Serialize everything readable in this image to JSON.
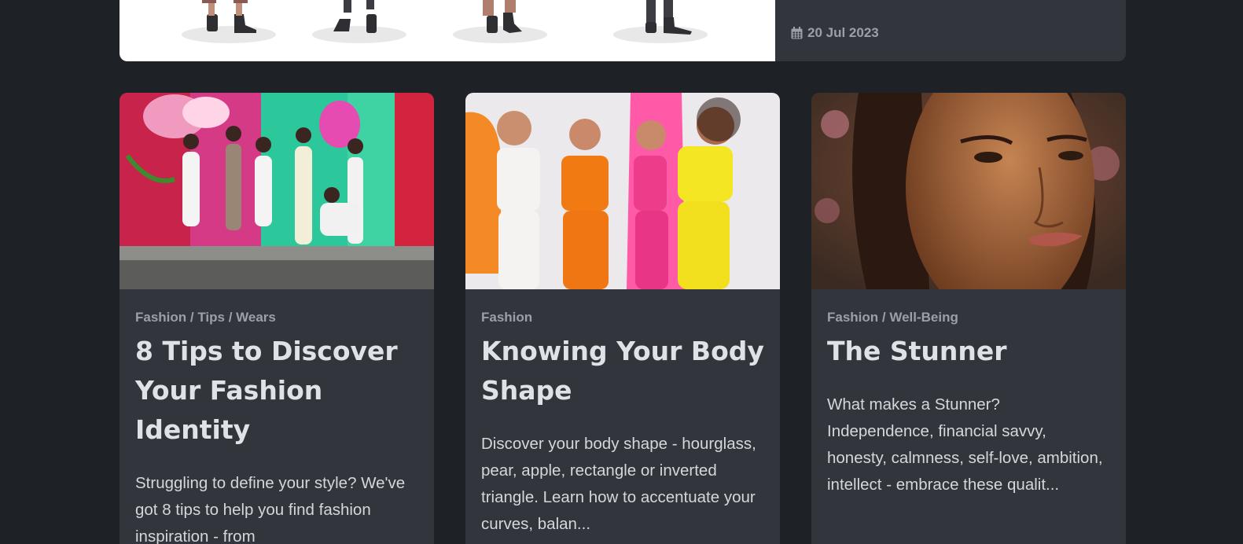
{
  "featured": {
    "date": "20 Jul 2023",
    "image_alt": "fashion illustration figures"
  },
  "cards": [
    {
      "categories": "Fashion / Tips / Wears",
      "title": "8 Tips to Discover Your Fashion Identity",
      "excerpt": "Struggling to define your style? We've got 8 tips to help you find fashion inspiration - from",
      "image_alt": "group of women posing in front of a colorful floral mural"
    },
    {
      "categories": "Fashion",
      "title": "Knowing Your Body Shape",
      "excerpt": "Discover your body shape - hourglass, pear, apple, rectangle or inverted triangle. Learn how to accentuate your curves, balan...",
      "image_alt": "four women in colorful activewear"
    },
    {
      "categories": "Fashion / Well-Being",
      "title": "The Stunner",
      "excerpt": "What makes a Stunner? Independence, financial savvy, honesty, calmness, self-love, ambition, intellect - embrace these qualit...",
      "image_alt": "close-up portrait of a woman with braids"
    }
  ],
  "colors": {
    "page_bg": "#1e2126",
    "card_bg": "#32363c",
    "meta": "#9aa0a6",
    "title": "#dfe2e6"
  }
}
